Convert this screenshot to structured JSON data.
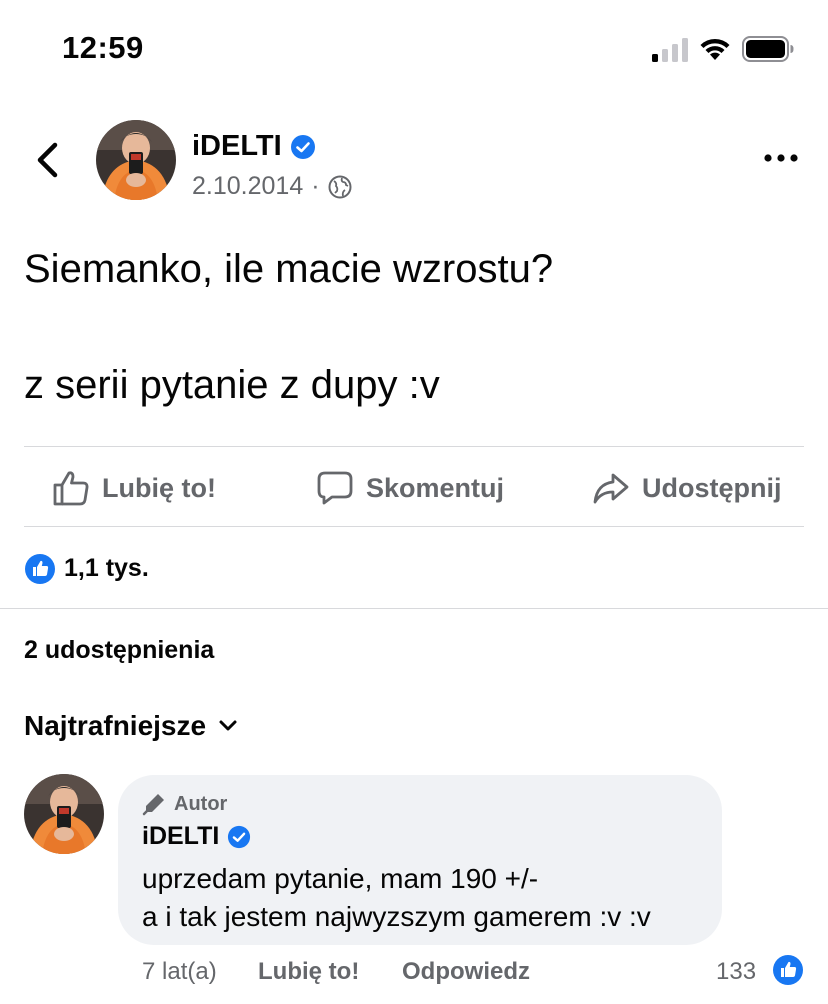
{
  "status_bar": {
    "time": "12:59"
  },
  "post": {
    "author": "iDELTI",
    "date": "2.10.2014",
    "separator": "·",
    "text": "Siemanko, ile macie wzrostu?\n\nz serii pytanie z dupy :v"
  },
  "actions": {
    "like_label": "Lubię to!",
    "comment_label": "Skomentuj",
    "share_label": "Udostępnij"
  },
  "stats": {
    "reactions": "1,1 tys.",
    "shares": "2 udostępnienia"
  },
  "comments": {
    "sort_label": "Najtrafniejsze",
    "items": [
      {
        "tag": "Autor",
        "author": "iDELTI",
        "text": "uprzedam pytanie, mam  190 +/-\na i tak jestem najwyzszym gamerem :v :v",
        "time": "7 lat(a)",
        "like_label": "Lubię to!",
        "reply_label": "Odpowiedz",
        "reaction_count": "133"
      }
    ]
  },
  "colors": {
    "accent_blue": "#1877f2",
    "secondary_text": "#65676b",
    "bubble_bg": "#f0f2f5"
  },
  "icons": [
    "back-arrow-icon",
    "verified-icon",
    "globe-icon",
    "more-icon",
    "like-icon",
    "comment-icon",
    "share-icon",
    "chevron-down-icon",
    "pencil-icon"
  ]
}
